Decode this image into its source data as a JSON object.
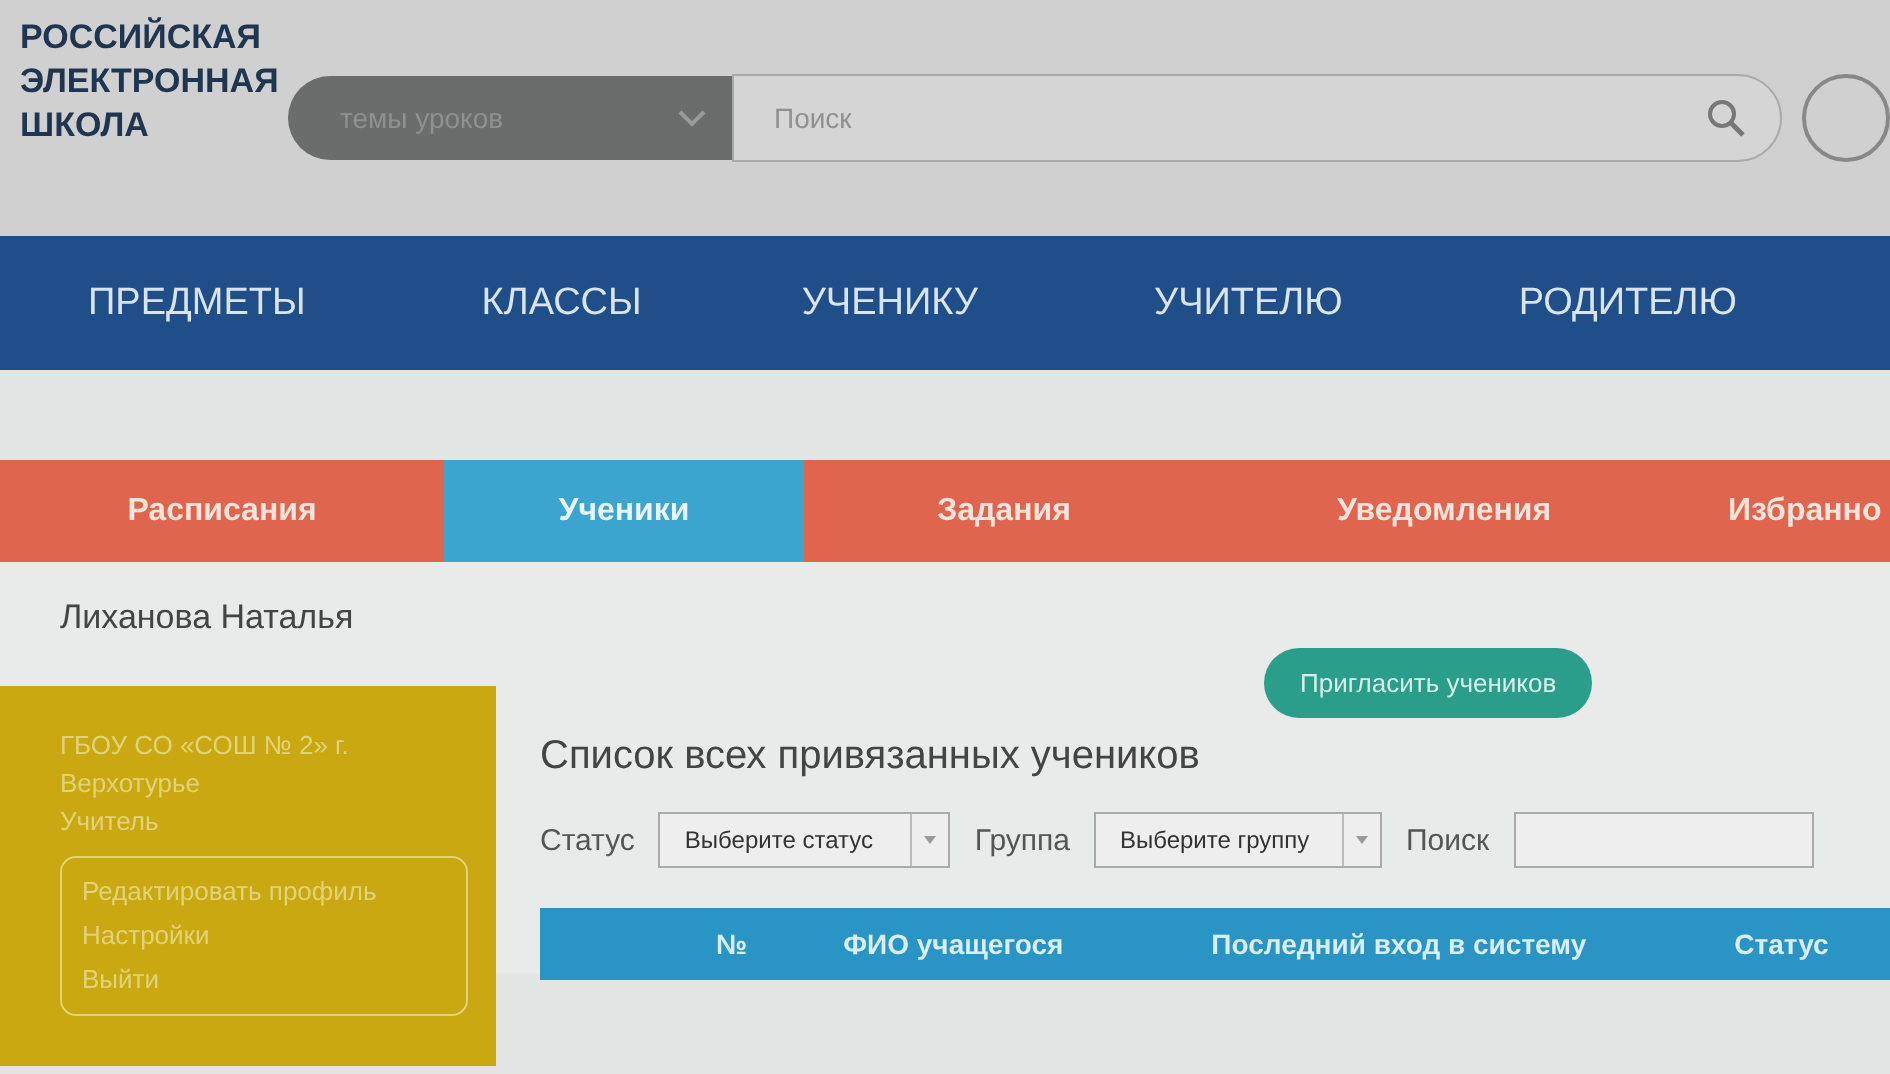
{
  "logo": {
    "lines": [
      "РОССИЙСКАЯ",
      "ЭЛЕКТРОННАЯ",
      "ШКОЛА"
    ]
  },
  "search_bar": {
    "topic_select": {
      "placeholder": "темы уроков"
    },
    "search": {
      "placeholder": "Поиск"
    }
  },
  "main_nav": [
    {
      "label": "ПРЕДМЕТЫ"
    },
    {
      "label": "КЛАССЫ"
    },
    {
      "label": "УЧЕНИКУ"
    },
    {
      "label": "УЧИТЕЛЮ"
    },
    {
      "label": "РОДИТЕЛЮ"
    }
  ],
  "tabs": [
    {
      "label": "Расписания",
      "selected": false
    },
    {
      "label": "Ученики",
      "selected": true
    },
    {
      "label": "Задания",
      "selected": false
    },
    {
      "label": "Уведомления",
      "selected": false
    },
    {
      "label": "Избранно",
      "selected": false
    }
  ],
  "user_name": "Лиханова Наталья",
  "profile_card": {
    "school": "ГБОУ СО «СОШ № 2» г. Верхотурье",
    "role": "Учитель",
    "links": [
      "Редактировать профиль",
      "Настройки",
      "Выйти"
    ]
  },
  "invite_button": "Пригласить учеников",
  "list_title": "Список всех привязанных учеников",
  "filters": {
    "status_label": "Статус",
    "status_select": {
      "placeholder": "Выберите статус"
    },
    "group_label": "Группа",
    "group_select": {
      "placeholder": "Выберите группу"
    },
    "search_label": "Поиск"
  },
  "table": {
    "columns": [
      "№",
      "ФИО учащегося",
      "Последний вход в систему",
      "Статус"
    ]
  }
}
